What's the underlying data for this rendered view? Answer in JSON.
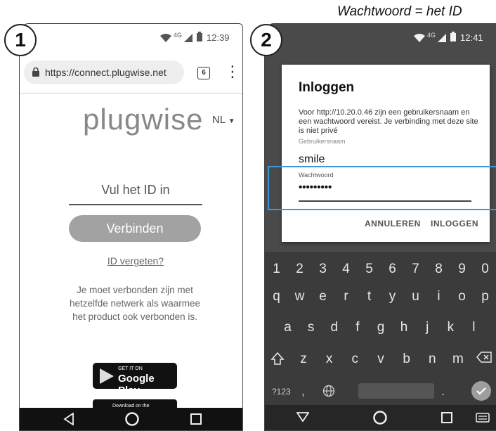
{
  "annotation": {
    "text": "Wachtwoord = het ID",
    "color": "#3a9ad6"
  },
  "step1": {
    "badge": "1",
    "status": {
      "network": "4G",
      "time": "12:39"
    },
    "browser": {
      "url": "https://connect.plugwise.net",
      "tab_count": "6"
    },
    "logo": "plugwise",
    "language": "NL",
    "id_placeholder": "Vul het ID in",
    "connect_button": "Verbinden",
    "forgot_link": "ID vergeten?",
    "info_text": "Je moet verbonden zijn met hetzelfde netwerk als waarmee het product ook verbonden is.",
    "google_play": {
      "small": "GET IT ON",
      "big": "Google Play"
    },
    "app_store": {
      "small": "Download on the"
    }
  },
  "step2": {
    "badge": "2",
    "status": {
      "network": "4G",
      "time": "12:41"
    },
    "dialog": {
      "title": "Inloggen",
      "message": "Voor http://10.20.0.46 zijn een gebruikersnaam en een wachtwoord vereist. Je verbinding met deze site is niet privé",
      "username_label": "Gebruikersnaam",
      "username_value": "smile",
      "password_label": "Wachtwoord",
      "password_value": "•••••••••",
      "cancel_button": "ANNULEREN",
      "login_button": "INLOGGEN"
    },
    "keyboard": {
      "row_numbers": [
        "1",
        "2",
        "3",
        "4",
        "5",
        "6",
        "7",
        "8",
        "9",
        "0"
      ],
      "row1": [
        "q",
        "w",
        "e",
        "r",
        "t",
        "y",
        "u",
        "i",
        "o",
        "p"
      ],
      "row2": [
        "a",
        "s",
        "d",
        "f",
        "g",
        "h",
        "j",
        "k",
        "l"
      ],
      "row3": [
        "z",
        "x",
        "c",
        "v",
        "b",
        "n",
        "m"
      ],
      "symbols_key": "?123",
      "comma_key": ",",
      "period_key": "."
    }
  }
}
